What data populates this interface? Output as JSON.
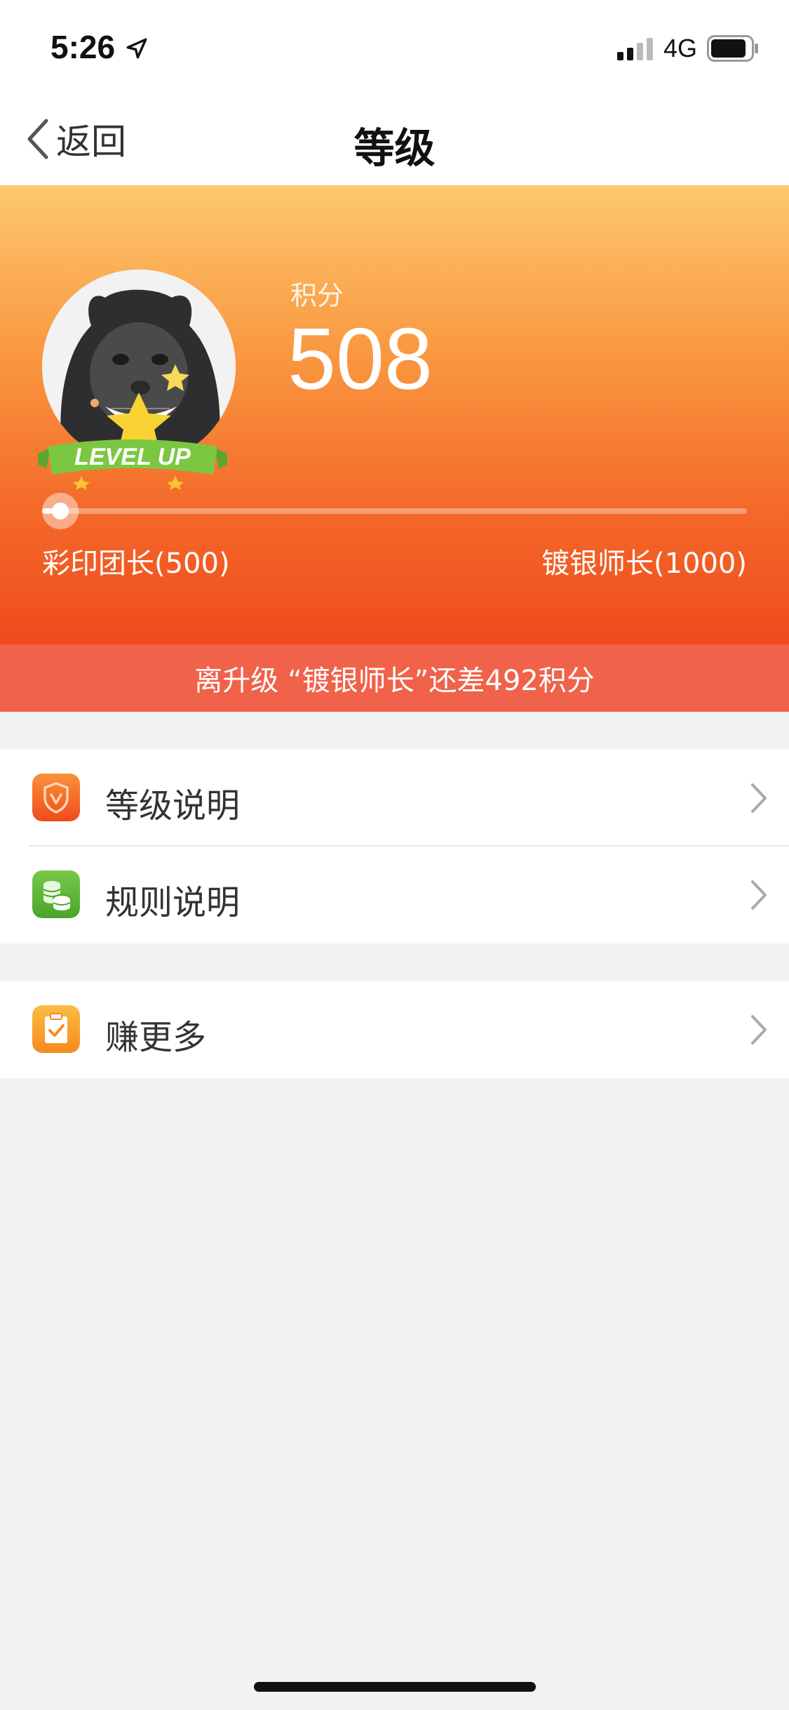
{
  "status_bar": {
    "time": "5:26",
    "network": "4G",
    "icons": [
      "location-arrow-icon",
      "signal-icon",
      "battery-icon"
    ]
  },
  "nav": {
    "back_label": "返回",
    "title": "等级"
  },
  "hero": {
    "points_label": "积分",
    "points_value": "508",
    "badge_text": "LEVEL UP",
    "current_level": "彩印团长(500)",
    "next_level": "镀银师长(1000)",
    "progress_fraction": 0.016,
    "hint": "离升级 “镀银师长”还差492积分",
    "colors": {
      "gradient_top": "#fdc86e",
      "gradient_bottom": "#ef4a1c",
      "hint_bar": "#f0624a"
    }
  },
  "menu": {
    "group1": [
      {
        "label": "等级说明",
        "icon": "shield-icon",
        "icon_color": "#f36a2a"
      },
      {
        "label": "规则说明",
        "icon": "coins-icon",
        "icon_color": "#5cb837"
      }
    ],
    "group2": [
      {
        "label": "赚更多",
        "icon": "clipboard-check-icon",
        "icon_color": "#f7a02b"
      }
    ]
  }
}
